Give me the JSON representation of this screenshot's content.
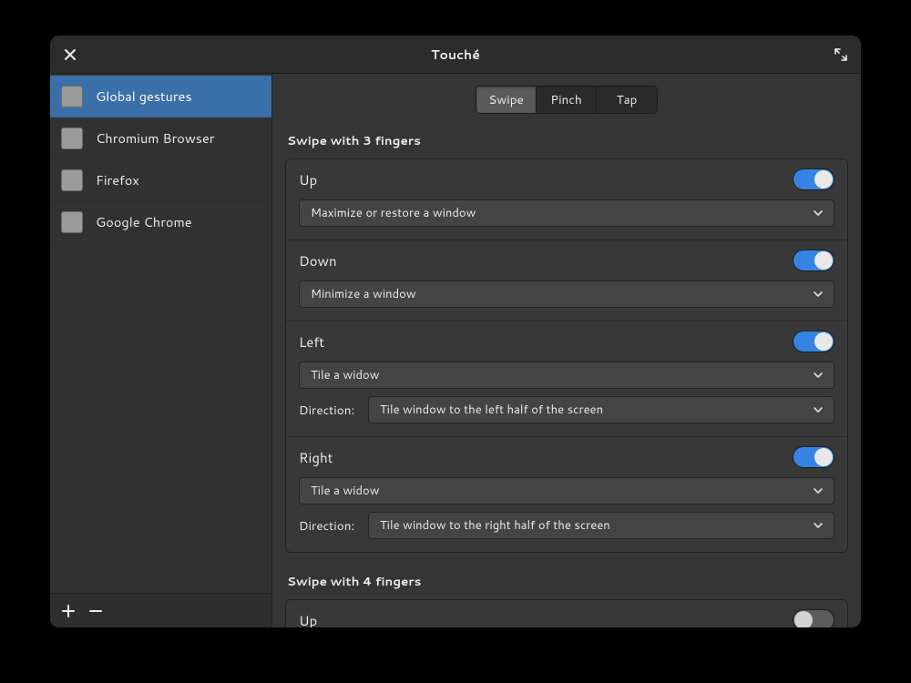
{
  "window": {
    "title": "Touché"
  },
  "sidebar": {
    "items": [
      {
        "label": "Global gestures",
        "selected": true
      },
      {
        "label": "Chromium Browser",
        "selected": false
      },
      {
        "label": "Firefox",
        "selected": false
      },
      {
        "label": "Google Chrome",
        "selected": false
      }
    ]
  },
  "tabs": {
    "items": [
      {
        "label": "Swipe",
        "active": true
      },
      {
        "label": "Pinch",
        "active": false
      },
      {
        "label": "Tap",
        "active": false
      }
    ]
  },
  "sections": [
    {
      "title": "Swipe with 3 fingers",
      "gestures": [
        {
          "name": "Up",
          "enabled": true,
          "action": "Maximize or restore a window",
          "extra": null
        },
        {
          "name": "Down",
          "enabled": true,
          "action": "Minimize a window",
          "extra": null
        },
        {
          "name": "Left",
          "enabled": true,
          "action": "Tile a widow",
          "extra": {
            "label": "Direction:",
            "value": "Tile window to the left half of the screen"
          }
        },
        {
          "name": "Right",
          "enabled": true,
          "action": "Tile a widow",
          "extra": {
            "label": "Direction:",
            "value": "Tile window to the right half of the screen"
          }
        }
      ]
    },
    {
      "title": "Swipe with 4 fingers",
      "gestures": [
        {
          "name": "Up",
          "enabled": false,
          "action": null,
          "extra": null
        }
      ]
    }
  ]
}
